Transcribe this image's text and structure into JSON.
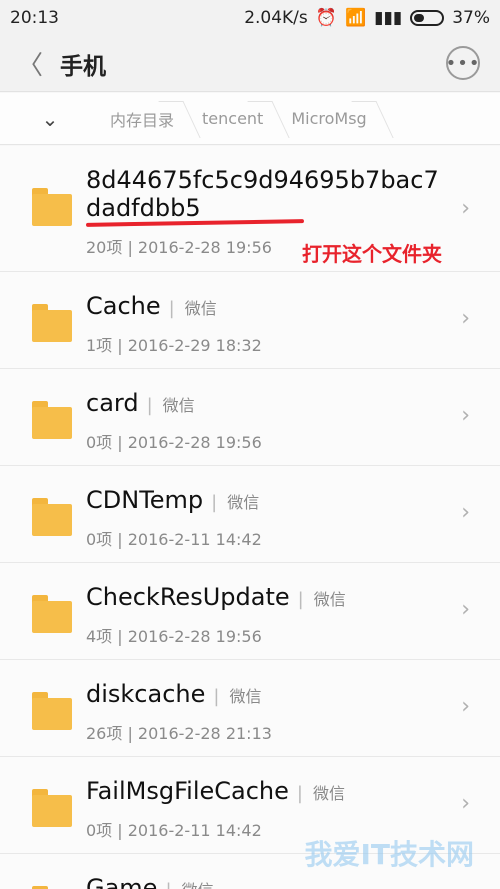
{
  "status": {
    "time": "20:13",
    "speed": "2.04K/s",
    "battery": "37%"
  },
  "header": {
    "title": "手机"
  },
  "breadcrumb": [
    "内存目录",
    "tencent",
    "MicroMsg"
  ],
  "note": "打开这个文件夹",
  "watermark": "我爱IT技术网",
  "files": [
    {
      "name_line1": "8d44675fc5c9d94695b7bac7",
      "name_line2": "dadfdbb5",
      "tag": "",
      "meta": "20项 | 2016-2-28 19:56"
    },
    {
      "name": "Cache",
      "tag": "微信",
      "meta": "1项 | 2016-2-29 18:32"
    },
    {
      "name": "card",
      "tag": "微信",
      "meta": "0项 | 2016-2-28 19:56"
    },
    {
      "name": "CDNTemp",
      "tag": "微信",
      "meta": "0项 | 2016-2-11 14:42"
    },
    {
      "name": "CheckResUpdate",
      "tag": "微信",
      "meta": "4项 | 2016-2-28 19:56"
    },
    {
      "name": "diskcache",
      "tag": "微信",
      "meta": "26项 | 2016-2-28 21:13"
    },
    {
      "name": "FailMsgFileCache",
      "tag": "微信",
      "meta": "0项 | 2016-2-11 14:42"
    },
    {
      "name": "Game",
      "tag": "微信",
      "meta": ""
    }
  ]
}
